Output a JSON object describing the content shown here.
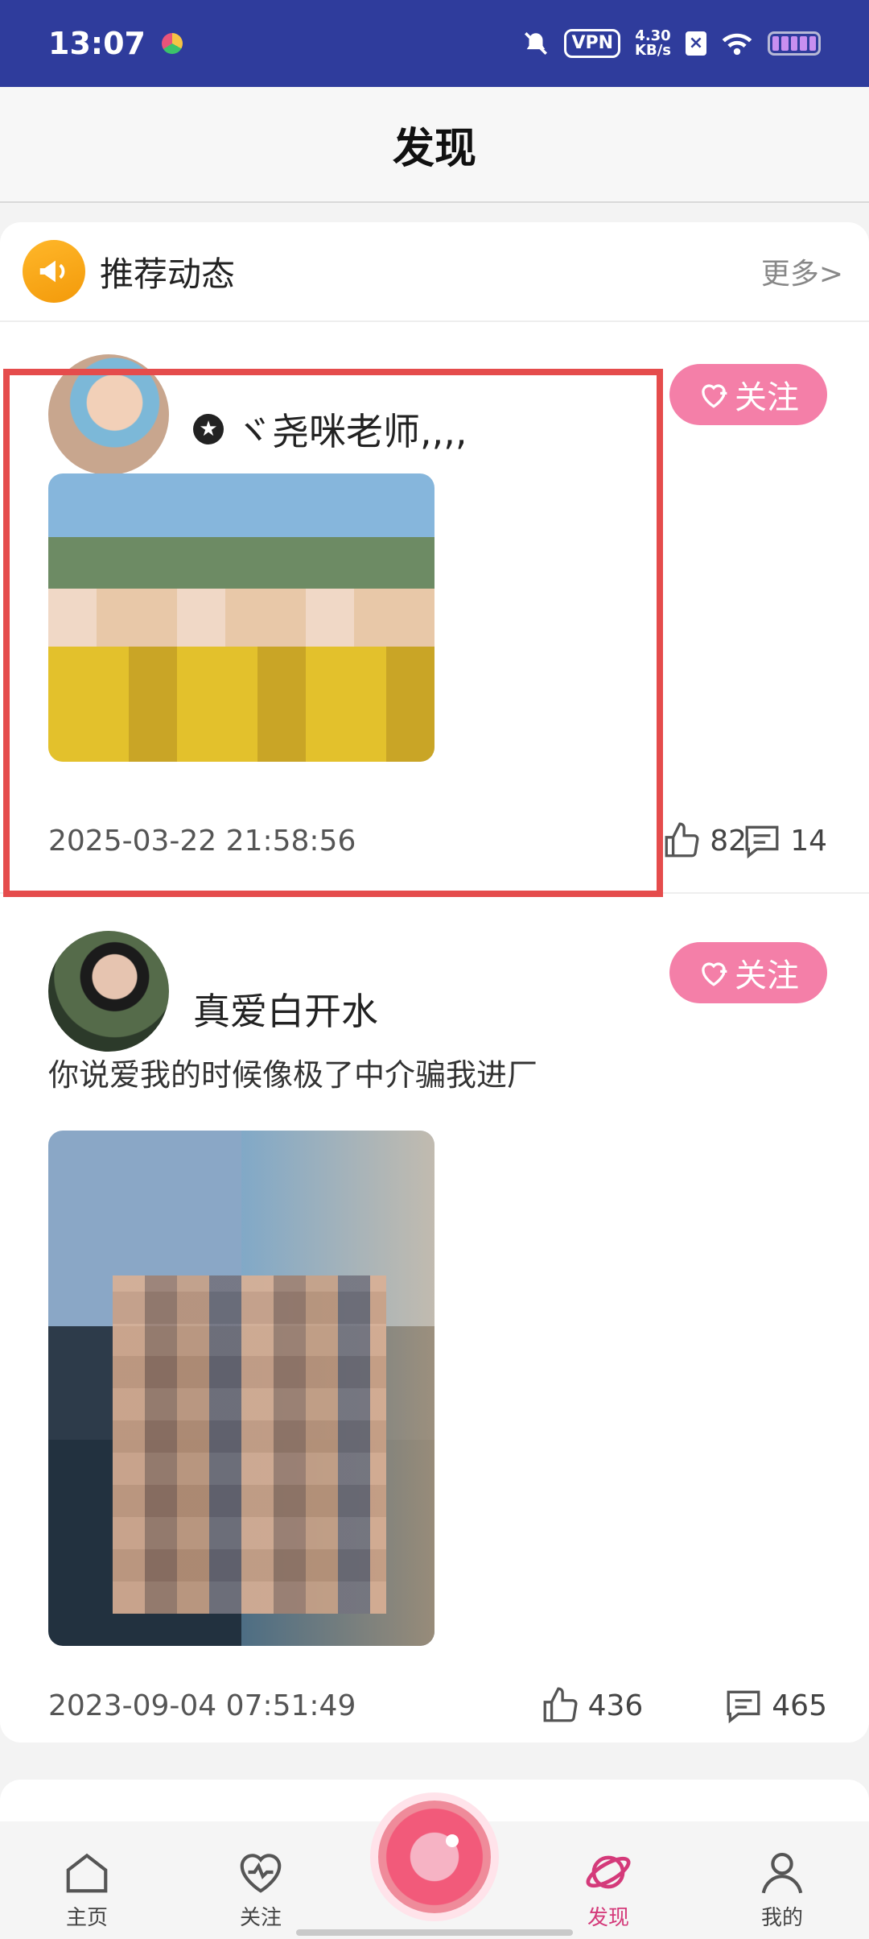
{
  "status_bar": {
    "time": "13:07",
    "vpn": "VPN",
    "net_speed_value": "4.30",
    "net_speed_unit": "KB/s"
  },
  "header": {
    "title": "发现"
  },
  "section": {
    "title": "推荐动态",
    "more": "更多>"
  },
  "posts": [
    {
      "username": "ヾ尧咪老师,,,,",
      "text": "",
      "time": "2025-03-22 21:58:56",
      "likes": "82",
      "comments": "14",
      "follow_label": "关注"
    },
    {
      "username": "真爱白开水",
      "text": "你说爱我的时候像极了中介骗我进厂",
      "time": "2023-09-04 07:51:49",
      "likes": "436",
      "comments": "465",
      "follow_label": "关注"
    }
  ],
  "nav": {
    "items": [
      {
        "label": "主页",
        "icon": "home-icon"
      },
      {
        "label": "关注",
        "icon": "heart-pulse-icon"
      },
      {
        "label": "",
        "icon": "camera-icon"
      },
      {
        "label": "发现",
        "icon": "planet-icon",
        "active": true
      },
      {
        "label": "我的",
        "icon": "person-icon"
      }
    ]
  },
  "colors": {
    "status_bar": "#2f3c9c",
    "follow_button": "#f47fa8",
    "active_nav": "#d43a7a",
    "highlight_border": "#e54c4c"
  }
}
